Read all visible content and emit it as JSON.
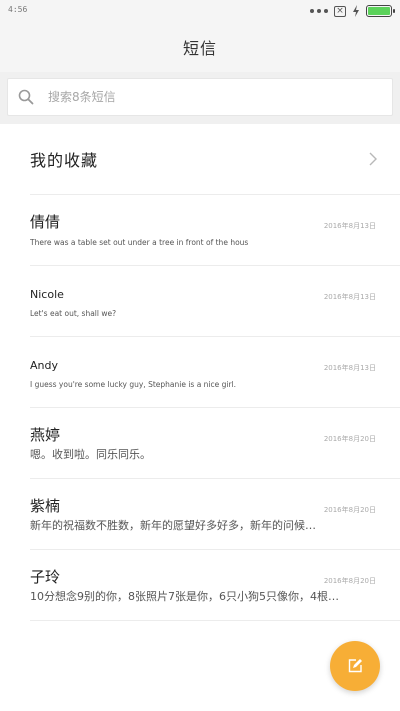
{
  "status_bar": {
    "time": "4:56",
    "x_badge": "×"
  },
  "header": {
    "title": "短信"
  },
  "search": {
    "placeholder": "搜索8条短信"
  },
  "favorites": {
    "label": "我的收藏"
  },
  "messages": [
    {
      "name": "倩倩",
      "date": "2016年8月13日",
      "preview": "There was a table set out under a tree in front of the hous"
    },
    {
      "name": "Nicole",
      "date": "2016年8月13日",
      "preview": "Let's eat out, shall we?"
    },
    {
      "name": "Andy",
      "date": "2016年8月13日",
      "preview": "I guess you're some lucky guy, Stephanie is a nice girl."
    },
    {
      "name": "燕婷",
      "date": "2016年8月20日",
      "preview": "嗯。收到啦。同乐同乐。"
    },
    {
      "name": "紫楠",
      "date": "2016年8月20日",
      "preview": "新年的祝福数不胜数，新年的愿望好多好多，新年的问候…"
    },
    {
      "name": "子玲",
      "date": "2016年8月20日",
      "preview": "10分想念9别的你，8张照片7张是你，6只小狗5只像你，4根…"
    }
  ],
  "colors": {
    "accent": "#f7ae36",
    "battery": "#5bd25a"
  },
  "icons": {
    "search": "search-icon",
    "chevron": "chevron-right-icon",
    "compose": "compose-icon"
  }
}
